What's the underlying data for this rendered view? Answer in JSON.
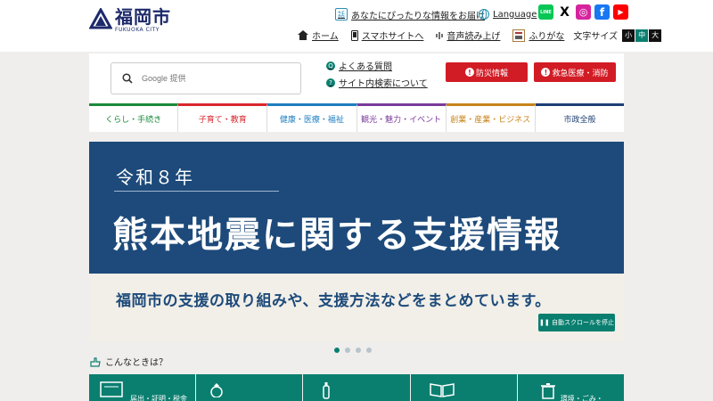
{
  "header": {
    "logo_main": "福岡市",
    "logo_sub": "FUKUOKA CITY",
    "recommend_link": "あなたにぴったりな情報をお届け",
    "recommend_icon_text": "話",
    "language_link": "Language",
    "sns": [
      {
        "name": "line",
        "text": "LINE",
        "color": "#06c755"
      },
      {
        "name": "x",
        "text": "X",
        "color": "#000000"
      },
      {
        "name": "instagram",
        "text": "◎",
        "color": "#d6249f"
      },
      {
        "name": "facebook",
        "text": "f",
        "color": "#1877f2"
      },
      {
        "name": "youtube",
        "text": "▶",
        "color": "#ff0000"
      }
    ],
    "nav": {
      "home": "ホーム",
      "smartphone": "スマホサイトへ",
      "read_aloud": "音声読み上げ",
      "furigana": "ふりがな",
      "font_size_label": "文字サイズ",
      "font_sizes": [
        "小",
        "中",
        "大"
      ]
    }
  },
  "search": {
    "placeholder": "Google 提供"
  },
  "quick_links": {
    "faq": "よくある質問",
    "site_search": "サイト内検索について"
  },
  "buttons": {
    "disaster": "防災情報",
    "emergency": "救急医療・消防"
  },
  "categories": [
    {
      "label": "くらし・手続き",
      "color": "#1a8a3a"
    },
    {
      "label": "子育て・教育",
      "color": "#d9262d"
    },
    {
      "label": "健康・医療・福祉",
      "color": "#1f7ec0"
    },
    {
      "label": "観光・魅力・イベント",
      "color": "#7a3a9a"
    },
    {
      "label": "創業・産業・ビジネス",
      "color": "#c7841a"
    },
    {
      "label": "市政全般",
      "color": "#1d3f73"
    }
  ],
  "hero": {
    "year": "令和８年",
    "title": "熊本地震に関する支援情報",
    "subtitle": "福岡市の支援の取り組みや、支援方法などをまとめています。",
    "pause_label": "❚❚ 自動スクロールを停止"
  },
  "konna": {
    "label": "こんなときは？"
  },
  "tiles": [
    {
      "label": "届出・証明・税金"
    },
    {
      "label": ""
    },
    {
      "label": ""
    },
    {
      "label": ""
    },
    {
      "label": "環境・ごみ・"
    }
  ]
}
